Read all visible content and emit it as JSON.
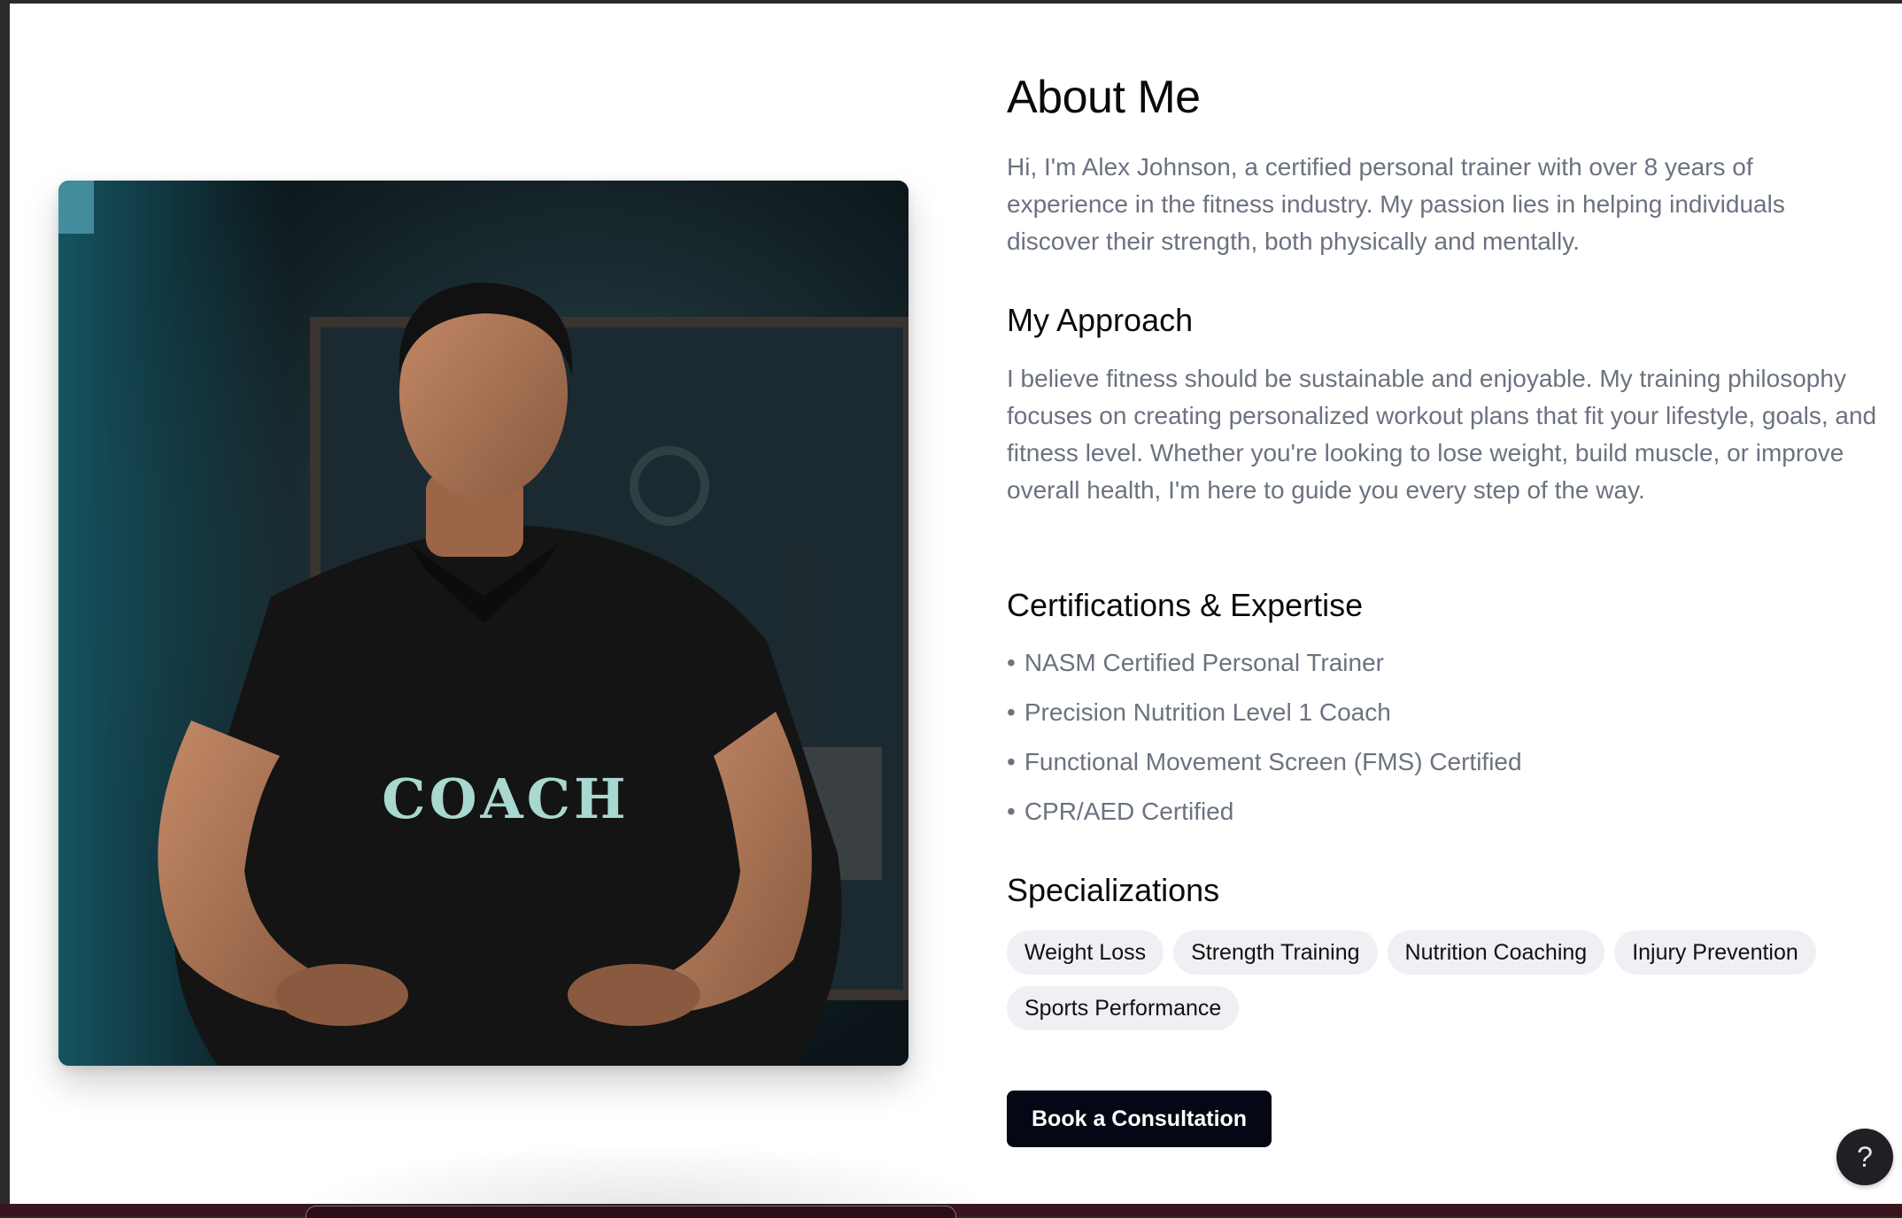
{
  "about": {
    "title": "About Me",
    "intro": "Hi, I'm Alex Johnson, a certified personal trainer with over 8 years of experience in the fitness industry. My passion lies in helping individuals discover their strength, both physically and mentally."
  },
  "photo": {
    "shirt_text": "COACH"
  },
  "approach": {
    "heading": "My Approach",
    "text": "I believe fitness should be sustainable and enjoyable. My training philosophy focuses on creating personalized workout plans that fit your lifestyle, goals, and fitness level. Whether you're looking to lose weight, build muscle, or improve overall health, I'm here to guide you every step of the way."
  },
  "certifications": {
    "heading": "Certifications & Expertise",
    "bullet": "•",
    "items": [
      "NASM Certified Personal Trainer",
      "Precision Nutrition Level 1 Coach",
      "Functional Movement Screen (FMS) Certified",
      "CPR/AED Certified"
    ]
  },
  "specializations": {
    "heading": "Specializations",
    "tags": [
      "Weight Loss",
      "Strength Training",
      "Nutrition Coaching",
      "Injury Prevention",
      "Sports Performance"
    ]
  },
  "cta": {
    "label": "Book a Consultation"
  },
  "help": {
    "label": "?"
  },
  "colors": {
    "heading": "#0a0a0a",
    "body_text": "#6b7280",
    "tag_bg": "#eef0f3",
    "cta_bg": "#050814"
  }
}
